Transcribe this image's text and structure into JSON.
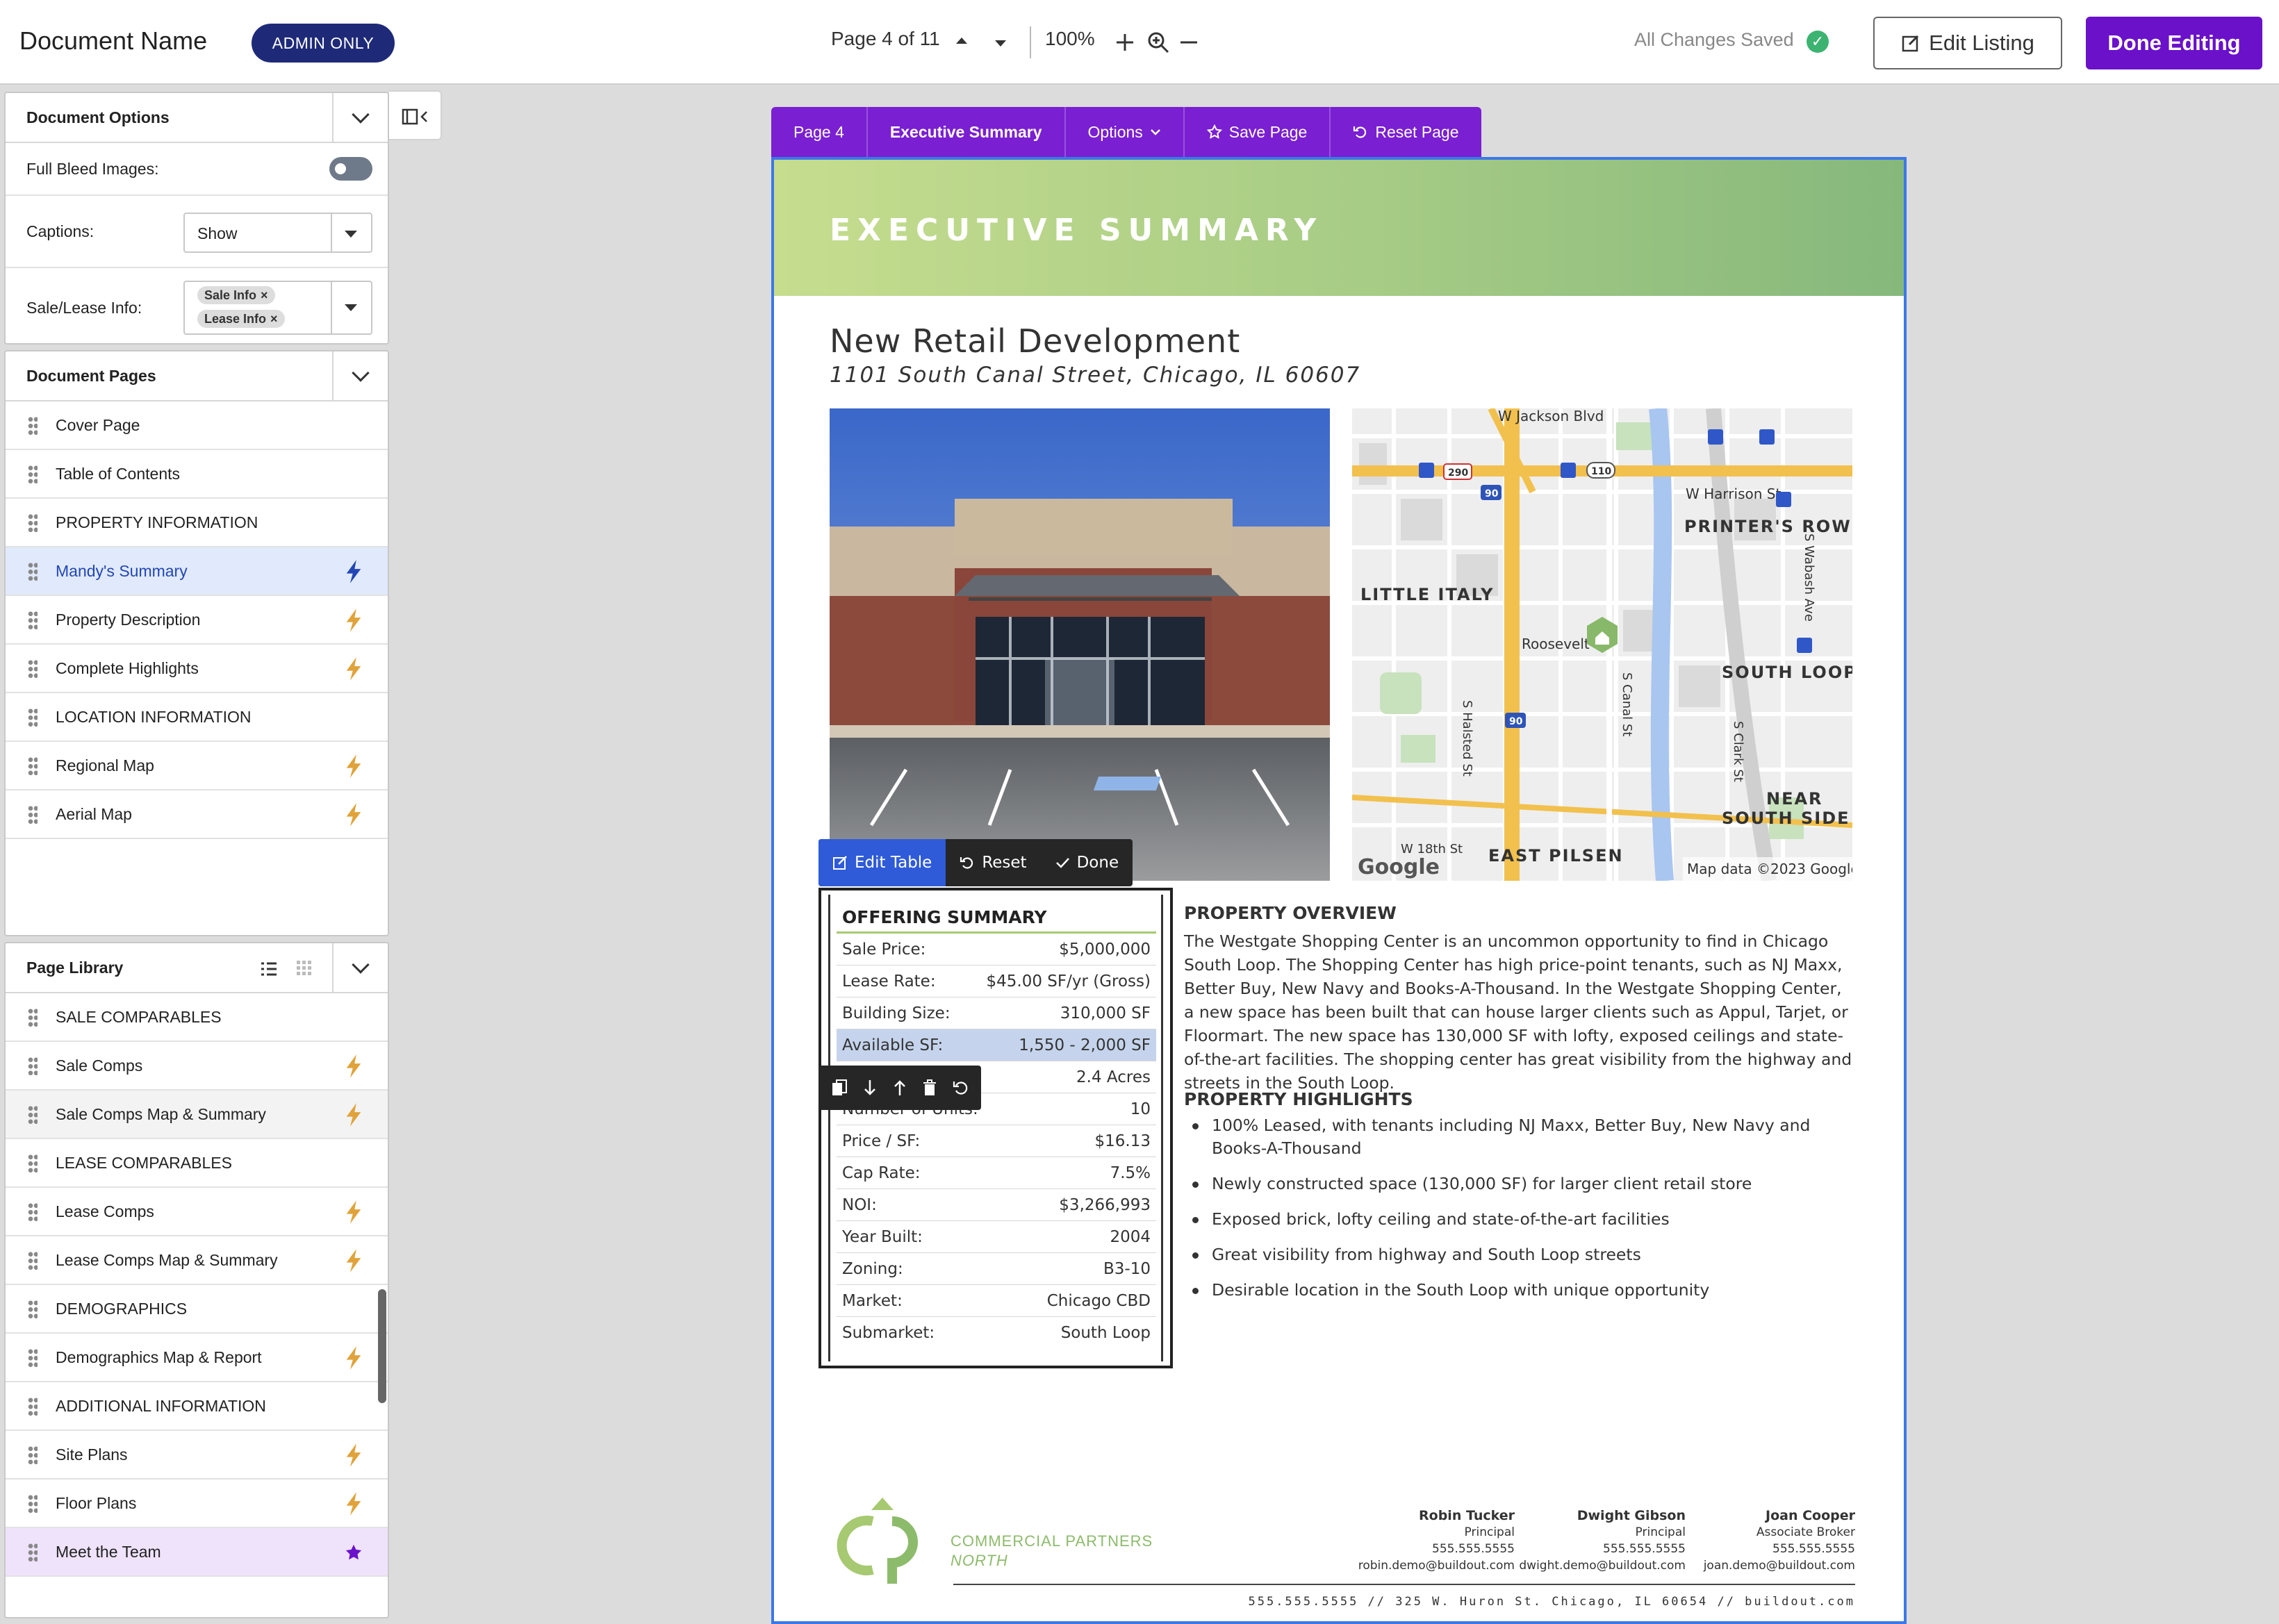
{
  "header": {
    "document_name": "Document Name",
    "badge": "ADMIN ONLY",
    "page_indicator": "Page 4 of 11",
    "zoom": "100%",
    "save_status": "All Changes Saved",
    "edit_listing": "Edit Listing",
    "done_editing": "Done Editing"
  },
  "document_options": {
    "title": "Document Options",
    "full_bleed_label": "Full Bleed Images:",
    "full_bleed_on": false,
    "captions_label": "Captions:",
    "captions_value": "Show",
    "sale_lease_label": "Sale/Lease Info:",
    "tags": [
      "Sale Info",
      "Lease Info"
    ]
  },
  "document_pages": {
    "title": "Document Pages",
    "items": [
      {
        "label": "Cover Page",
        "icon": ""
      },
      {
        "label": "Table of Contents",
        "icon": ""
      },
      {
        "label": "PROPERTY INFORMATION",
        "icon": ""
      },
      {
        "label": "Mandy's Summary",
        "icon": "bolt-icon"
      },
      {
        "label": "Property Description",
        "icon": "bolt-icon"
      },
      {
        "label": "Complete Highlights",
        "icon": "bolt-icon"
      },
      {
        "label": "LOCATION INFORMATION",
        "icon": ""
      },
      {
        "label": "Regional Map",
        "icon": "bolt-icon"
      },
      {
        "label": "Aerial Map",
        "icon": "bolt-icon"
      }
    ]
  },
  "page_library": {
    "title": "Page Library",
    "items": [
      {
        "label": "SALE COMPARABLES",
        "icon": ""
      },
      {
        "label": "Sale Comps",
        "icon": "bolt-icon"
      },
      {
        "label": "Sale Comps Map & Summary",
        "icon": "bolt-icon"
      },
      {
        "label": "LEASE COMPARABLES",
        "icon": ""
      },
      {
        "label": "Lease Comps",
        "icon": "bolt-icon"
      },
      {
        "label": "Lease Comps Map & Summary",
        "icon": "bolt-icon"
      },
      {
        "label": "DEMOGRAPHICS",
        "icon": ""
      },
      {
        "label": "Demographics Map & Report",
        "icon": "bolt-icon"
      },
      {
        "label": "ADDITIONAL INFORMATION",
        "icon": ""
      },
      {
        "label": "Site Plans",
        "icon": "bolt-icon"
      },
      {
        "label": "Floor Plans",
        "icon": "bolt-icon"
      },
      {
        "label": "Meet the Team",
        "icon": "star-icon"
      }
    ]
  },
  "page_tabs": {
    "page": "Page 4",
    "name": "Executive Summary",
    "options": "Options",
    "save": "Save Page",
    "reset": "Reset Page"
  },
  "page": {
    "banner": "EXECUTIVE SUMMARY",
    "title": "New Retail Development",
    "address": "1101 South Canal Street, Chicago, IL 60607",
    "map": {
      "labels": [
        "W Jackson Blvd",
        "W Harrison St",
        "PRINTER'S ROW",
        "LITTLE ITALY",
        "Roosevelt",
        "SOUTH LOOP",
        "S Canal St",
        "S Halsted St",
        "S Clark St",
        "S Wabash Ave",
        "NEAR",
        "SOUTH SIDE",
        "W 18th St",
        "EAST PILSEN"
      ],
      "shields": [
        "290",
        "90",
        "110",
        "90"
      ],
      "attribution": "Map data ©2023 Google",
      "logo": "Google"
    },
    "table_toolbar": {
      "edit": "Edit Table",
      "reset": "Reset",
      "done": "Done"
    },
    "offering": {
      "title": "OFFERING SUMMARY",
      "rows": [
        {
          "k": "Sale Price:",
          "v": "$5,000,000"
        },
        {
          "k": "Lease Rate:",
          "v": "$45.00 SF/yr (Gross)"
        },
        {
          "k": "Building Size:",
          "v": "310,000 SF"
        },
        {
          "k": "Available SF:",
          "v": "1,550 - 2,000 SF"
        },
        {
          "k": "",
          "v": "2.4 Acres"
        },
        {
          "k": "Number of Units:",
          "v": "10"
        },
        {
          "k": "Price / SF:",
          "v": "$16.13"
        },
        {
          "k": "Cap Rate:",
          "v": "7.5%"
        },
        {
          "k": "NOI:",
          "v": "$3,266,993"
        },
        {
          "k": "Year Built:",
          "v": "2004"
        },
        {
          "k": "Zoning:",
          "v": "B3-10"
        },
        {
          "k": "Market:",
          "v": "Chicago CBD"
        },
        {
          "k": "Submarket:",
          "v": "South Loop"
        }
      ]
    },
    "overview_title": "PROPERTY OVERVIEW",
    "overview": "The Westgate Shopping Center is an uncommon opportunity to find in Chicago South Loop. The Shopping Center has high price-point tenants, such as NJ Maxx, Better Buy, New Navy and Books-A-Thousand. In the Westgate Shopping Center, a new space has been built that can house larger clients such as Appul, Tarjet, or Floormart. The new space has 130,000 SF with lofty, exposed ceilings and state-of-the-art facilities. The shopping center has great visibility from the highway and streets in the South Loop.",
    "highlights_title": "PROPERTY HIGHLIGHTS",
    "highlights": [
      "100% Leased, with tenants including NJ Maxx, Better Buy, New Navy and Books-A-Thousand",
      "Newly constructed space (130,000 SF) for larger client retail store",
      "Exposed brick, lofty ceiling and state-of-the-art facilities",
      "Great visibility from highway and South Loop streets",
      "Desirable location in the South Loop with unique opportunity"
    ],
    "logo_line1": "COMMERCIAL PARTNERS",
    "logo_line2": "NORTH",
    "contacts": [
      {
        "name": "Robin Tucker",
        "role": "Principal",
        "phone": "555.555.5555",
        "email": "robin.demo@buildout.com"
      },
      {
        "name": "Dwight Gibson",
        "role": "Principal",
        "phone": "555.555.5555",
        "email": "dwight.demo@buildout.com"
      },
      {
        "name": "Joan Cooper",
        "role": "Associate Broker",
        "phone": "555.555.5555",
        "email": "joan.demo@buildout.com"
      }
    ],
    "footer_address": "555.555.5555 // 325 W. Huron St. Chicago, IL 60654 // buildout.com"
  },
  "colors": {
    "brand_purple": "#6a11c9",
    "admin_navy": "#1e2a78",
    "accent_green": "#a6c971",
    "selection_blue": "#2f5bd8"
  }
}
